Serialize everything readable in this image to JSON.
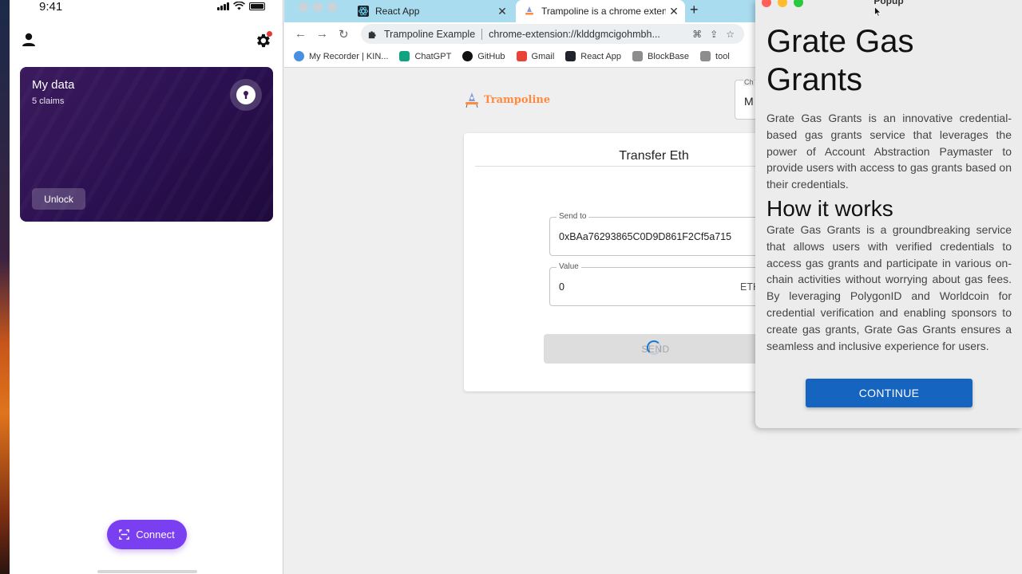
{
  "phone": {
    "status_time": "9:41",
    "card": {
      "title": "My data",
      "subtitle": "5 claims",
      "unlock_label": "Unlock"
    },
    "connect_label": "Connect"
  },
  "browser": {
    "tabs": [
      {
        "label": "React App",
        "close": "✕"
      },
      {
        "label": "Trampoline is a chrome extension",
        "close": "✕"
      }
    ],
    "new_tab": "+",
    "omnibox": {
      "site": "Trampoline Example",
      "url": "chrome-extension://klddgmcigohmbh..."
    },
    "bookmarks": [
      {
        "label": "My Recorder | KIN...",
        "color": "#4a90e2"
      },
      {
        "label": "ChatGPT",
        "color": "#10a37f"
      },
      {
        "label": "GitHub",
        "color": "#111111"
      },
      {
        "label": "Gmail",
        "color": "#ea4335"
      },
      {
        "label": "React App",
        "color": "#61dafb"
      },
      {
        "label": "BlockBase",
        "color": "#8d8d8d"
      },
      {
        "label": "tool",
        "color": "#8d8d8d"
      }
    ],
    "page": {
      "logo_text": "Trampoline",
      "chain_label": "Ch",
      "chain_value": "M",
      "card_title": "Transfer Eth",
      "send_to_label": "Send to",
      "send_to_value": "0xBAa76293865C0D9D861F2Cf5a715",
      "value_label": "Value",
      "value_amount": "0",
      "value_unit": "ETH",
      "send_label": "SEND"
    }
  },
  "popup": {
    "window_title": "Popup",
    "heading": "Grate Gas Grants",
    "intro": "Grate Gas Grants is an innovative credential-based gas grants service that leverages the power of Account Abstraction Paymaster to provide users with access to gas grants based on their credentials.",
    "subheading": "How it works",
    "body": "Grate Gas Grants is a groundbreaking service that allows users with verified credentials to access gas grants and participate in various on-chain activities without worrying about gas fees. By leveraging PolygonID and Worldcoin for credential verification and enabling sponsors to create gas grants, Grate Gas Grants ensures a seamless and inclusive experience for users.",
    "continue_label": "CONTINUE"
  },
  "colors": {
    "accent_purple": "#7b3ff2",
    "card_purple": "#2a1050",
    "primary_blue": "#1565c0",
    "tab_strip": "#a9dcef"
  }
}
